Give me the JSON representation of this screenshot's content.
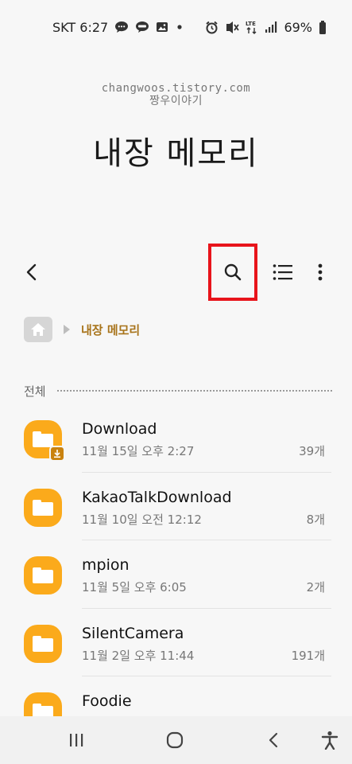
{
  "status_bar": {
    "carrier_time": "SKT 6:27",
    "battery": "69%",
    "network": "LTE",
    "left_icons": [
      "talk-bubble-icon",
      "kakaotalk-icon",
      "gallery-icon",
      "dot-icon"
    ],
    "right_icons": [
      "alarm-icon",
      "vibrate-mute-icon",
      "lte-icon",
      "signal-icon",
      "battery-icon"
    ]
  },
  "watermark": {
    "line1": "changwoos.tistory.com",
    "line2": "짱우이야기"
  },
  "header": {
    "title": "내장 메모리"
  },
  "toolbar": {
    "icons": [
      "back-icon",
      "search-icon",
      "list-view-icon",
      "more-options-icon"
    ],
    "highlight_color": "#e8141b"
  },
  "breadcrumb": {
    "current": "내장 메모리",
    "color": "#a8741b"
  },
  "section": {
    "label": "전체"
  },
  "files": [
    {
      "name": "Download",
      "date": "11월 15일 오후 2:27",
      "count": "39개",
      "badge": "download-badge-icon"
    },
    {
      "name": "KakaoTalkDownload",
      "date": "11월 10일 오전 12:12",
      "count": "8개"
    },
    {
      "name": "mpion",
      "date": "11월 5일 오후 6:05",
      "count": "2개"
    },
    {
      "name": "SilentCamera",
      "date": "11월 2일 오후 11:44",
      "count": "191개"
    },
    {
      "name": "Foodie",
      "date": "",
      "count": ""
    }
  ],
  "colors": {
    "folder": "#fbaa1b",
    "background": "#f7f7f7"
  },
  "nav_bar": {
    "icons": [
      "recents-icon",
      "home-icon",
      "back-nav-icon",
      "accessibility-icon"
    ]
  }
}
